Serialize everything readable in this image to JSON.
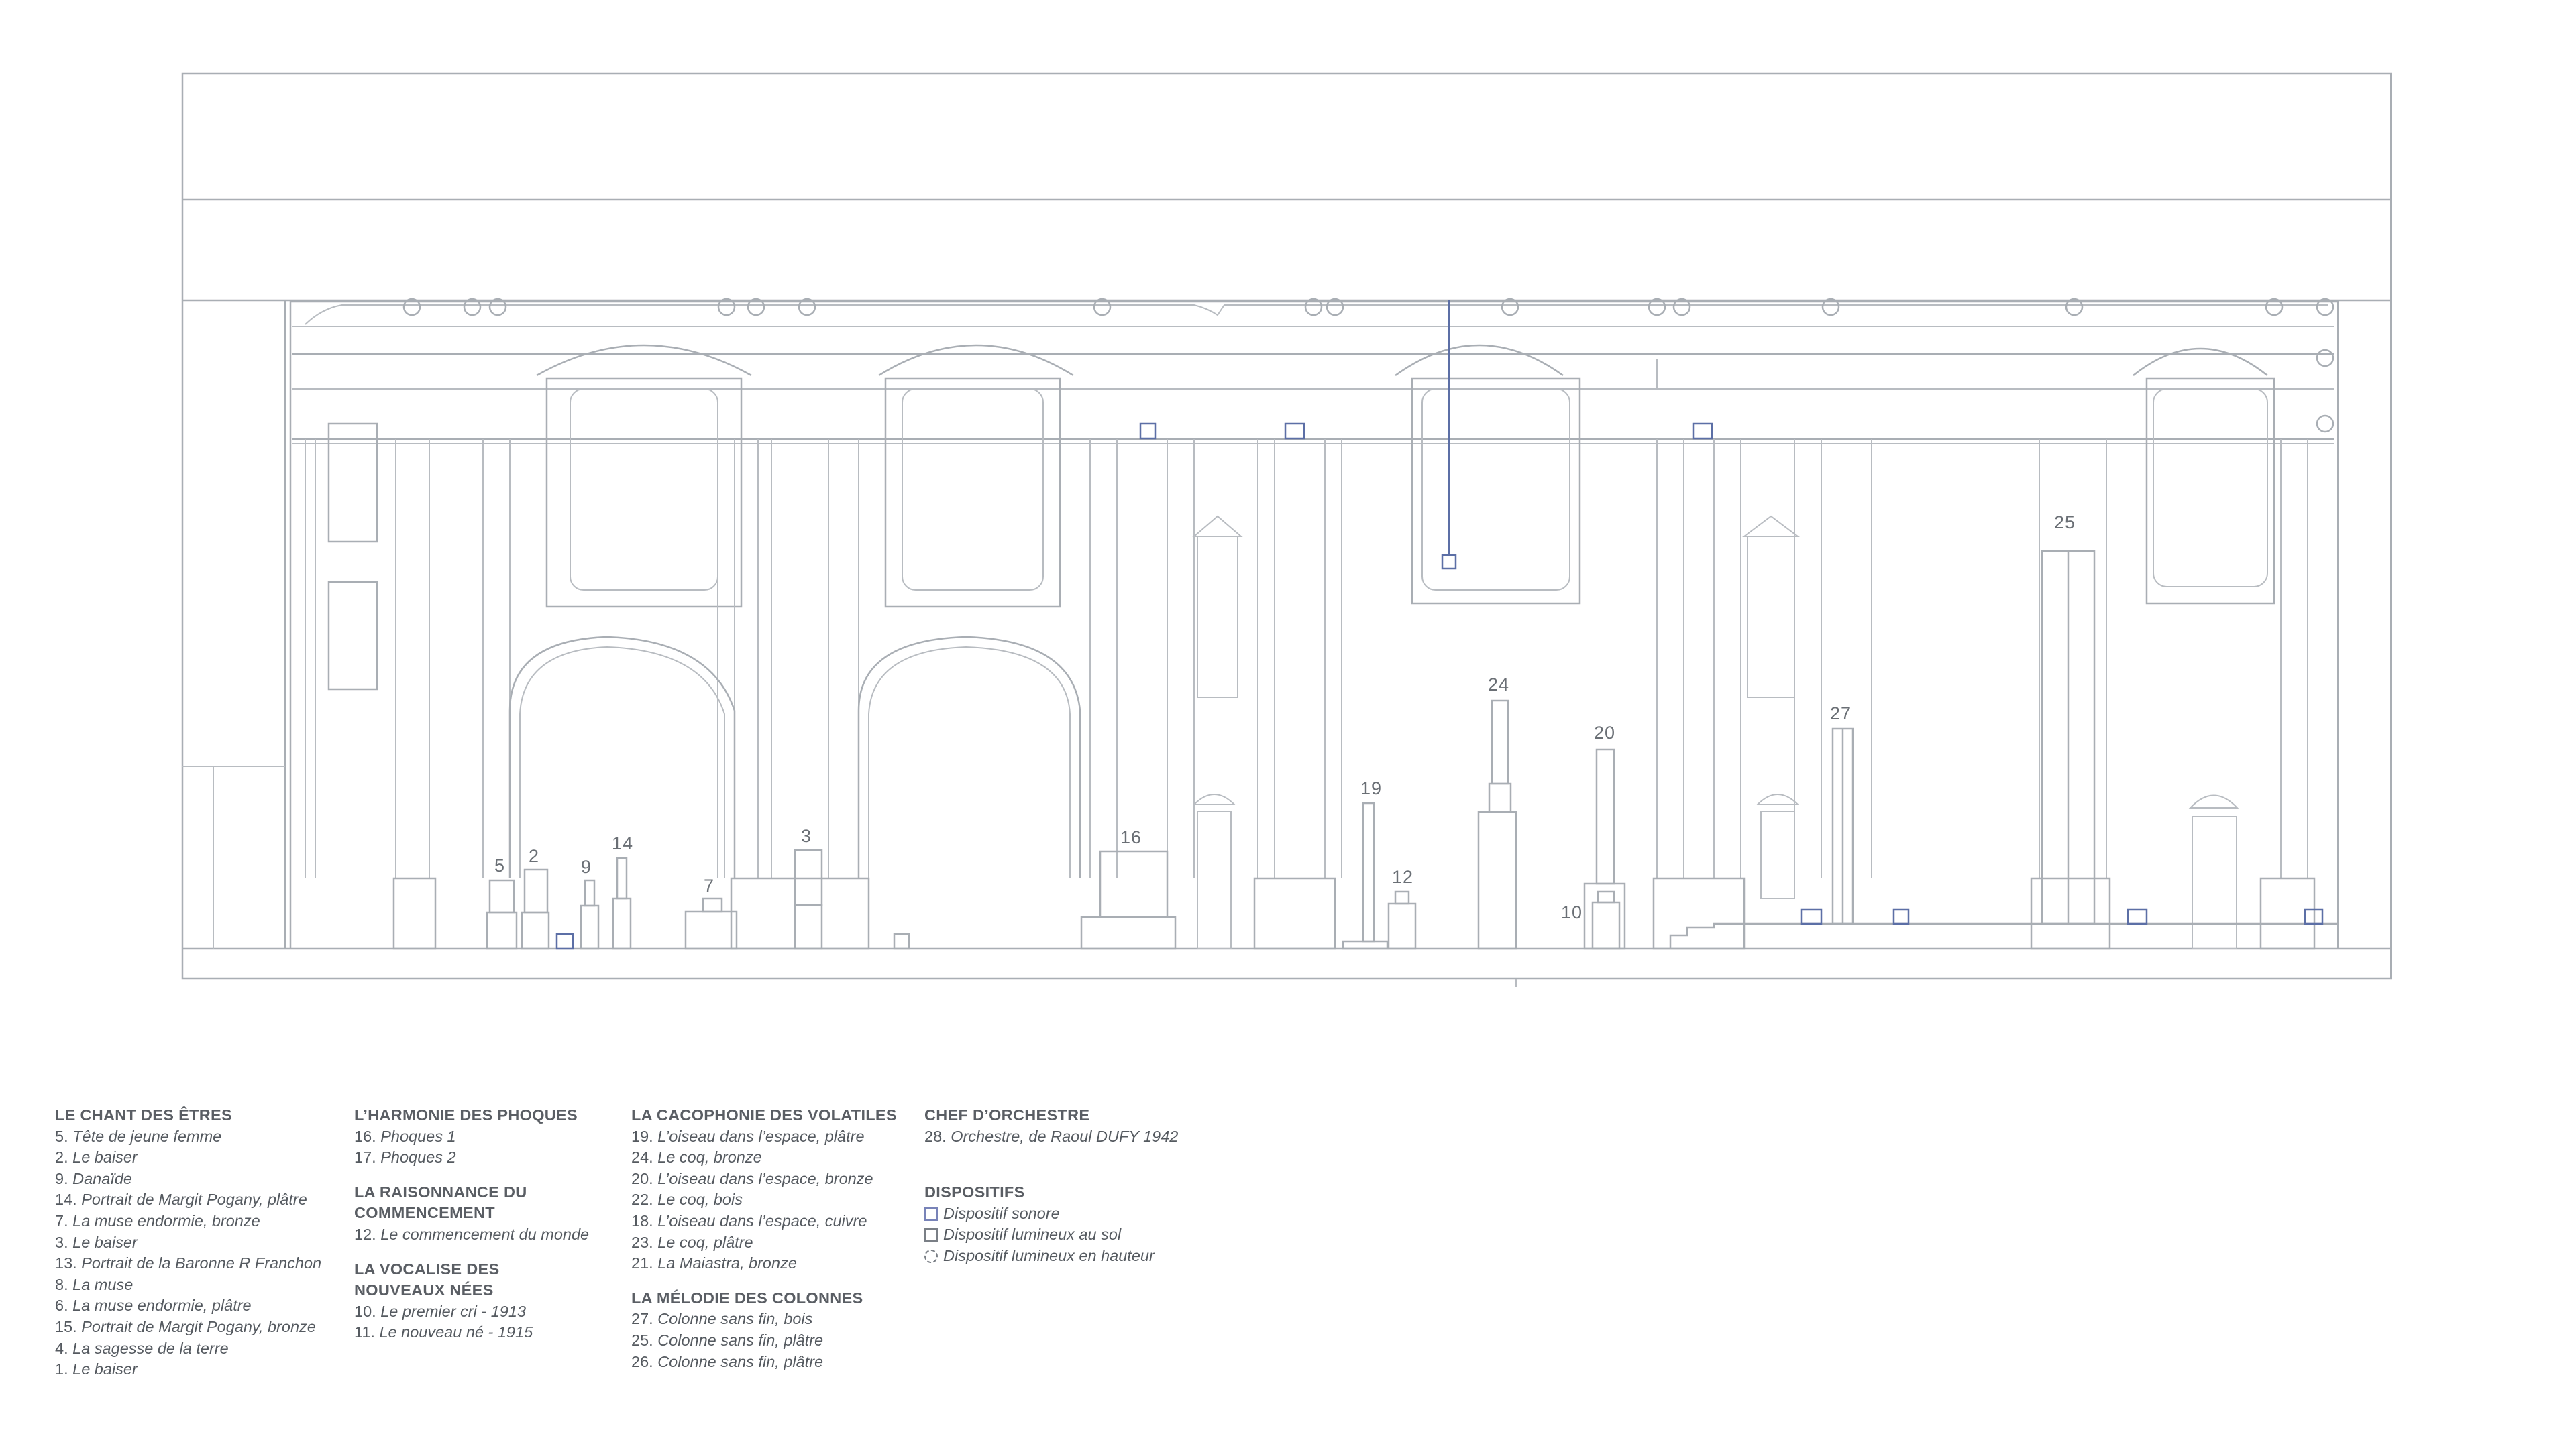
{
  "drawing": {
    "labels": {
      "n5": "5",
      "n2": "2",
      "n9": "9",
      "n14": "14",
      "n7": "7",
      "n3": "3",
      "n16": "16",
      "n19": "19",
      "n12": "12",
      "n24": "24",
      "n10": "10",
      "n20": "20",
      "n27": "27",
      "n25": "25"
    },
    "colors": {
      "line": "#a9aeb4",
      "sound_device": "#5c6fa6",
      "text": "#555a60"
    }
  },
  "legend": {
    "chant": {
      "title": "LE CHANT DES ÊTRES",
      "items": [
        {
          "num": "5.",
          "text": "Tête de jeune femme"
        },
        {
          "num": "2.",
          "text": "Le baiser"
        },
        {
          "num": "9.",
          "text": "Danaïde"
        },
        {
          "num": "14.",
          "text": "Portrait de Margit Pogany, plâtre"
        },
        {
          "num": "7.",
          "text": "La muse endormie, bronze"
        },
        {
          "num": "3.",
          "text": "Le baiser"
        },
        {
          "num": "13.",
          "text": "Portrait de la Baronne R Franchon"
        },
        {
          "num": "8.",
          "text": "La muse"
        },
        {
          "num": "6.",
          "text": "La muse endormie, plâtre"
        },
        {
          "num": "15.",
          "text": "Portrait de Margit Pogany, bronze"
        },
        {
          "num": "4.",
          "text": "La sagesse de la terre"
        },
        {
          "num": "1.",
          "text": "Le baiser"
        }
      ]
    },
    "phoques": {
      "title": "L’HARMONIE DES PHOQUES",
      "items": [
        {
          "num": "16.",
          "text": "Phoques 1"
        },
        {
          "num": "17.",
          "text": "Phoques 2"
        }
      ]
    },
    "raisonnance": {
      "title_line1": "LA RAISONNANCE DU",
      "title_line2": "COMMENCEMENT",
      "items": [
        {
          "num": "12.",
          "text": "Le commencement du monde"
        }
      ]
    },
    "vocalise": {
      "title_line1": "LA VOCALISE DES",
      "title_line2": "NOUVEAUX NÉES",
      "items": [
        {
          "num": "10.",
          "text": "Le premier cri - 1913"
        },
        {
          "num": "11.",
          "text": "Le nouveau né - 1915"
        }
      ]
    },
    "cacophonie": {
      "title": "LA CACOPHONIE DES VOLATILES",
      "items": [
        {
          "num": "19.",
          "text": "L’oiseau dans l’espace, plâtre"
        },
        {
          "num": "24.",
          "text": "Le coq, bronze"
        },
        {
          "num": "20.",
          "text": "L’oiseau dans l’espace, bronze"
        },
        {
          "num": "22.",
          "text": "Le coq, bois"
        },
        {
          "num": "18.",
          "text": "L’oiseau dans l’espace, cuivre"
        },
        {
          "num": "23.",
          "text": "Le coq, plâtre"
        },
        {
          "num": "21.",
          "text": "La Maiastra, bronze"
        }
      ]
    },
    "colonnes": {
      "title": "LA MÉLODIE DES COLONNES",
      "items": [
        {
          "num": "27.",
          "text": "Colonne sans fin, bois"
        },
        {
          "num": "25.",
          "text": "Colonne sans fin, plâtre"
        },
        {
          "num": "26.",
          "text": "Colonne sans fin, plâtre"
        }
      ]
    },
    "chef": {
      "title": "CHEF D’ORCHESTRE",
      "items": [
        {
          "num": "28.",
          "text": "Orchestre, de Raoul DUFY 1942"
        }
      ]
    },
    "dispositifs": {
      "title": "DISPOSITIFS",
      "items": [
        {
          "icon": "square-sound-icon",
          "text": "Dispositif sonore"
        },
        {
          "icon": "square-floor-light-icon",
          "text": "Dispositif lumineux au sol"
        },
        {
          "icon": "dashed-circle-light-icon",
          "text": "Dispositif lumineux en hauteur"
        }
      ]
    }
  }
}
